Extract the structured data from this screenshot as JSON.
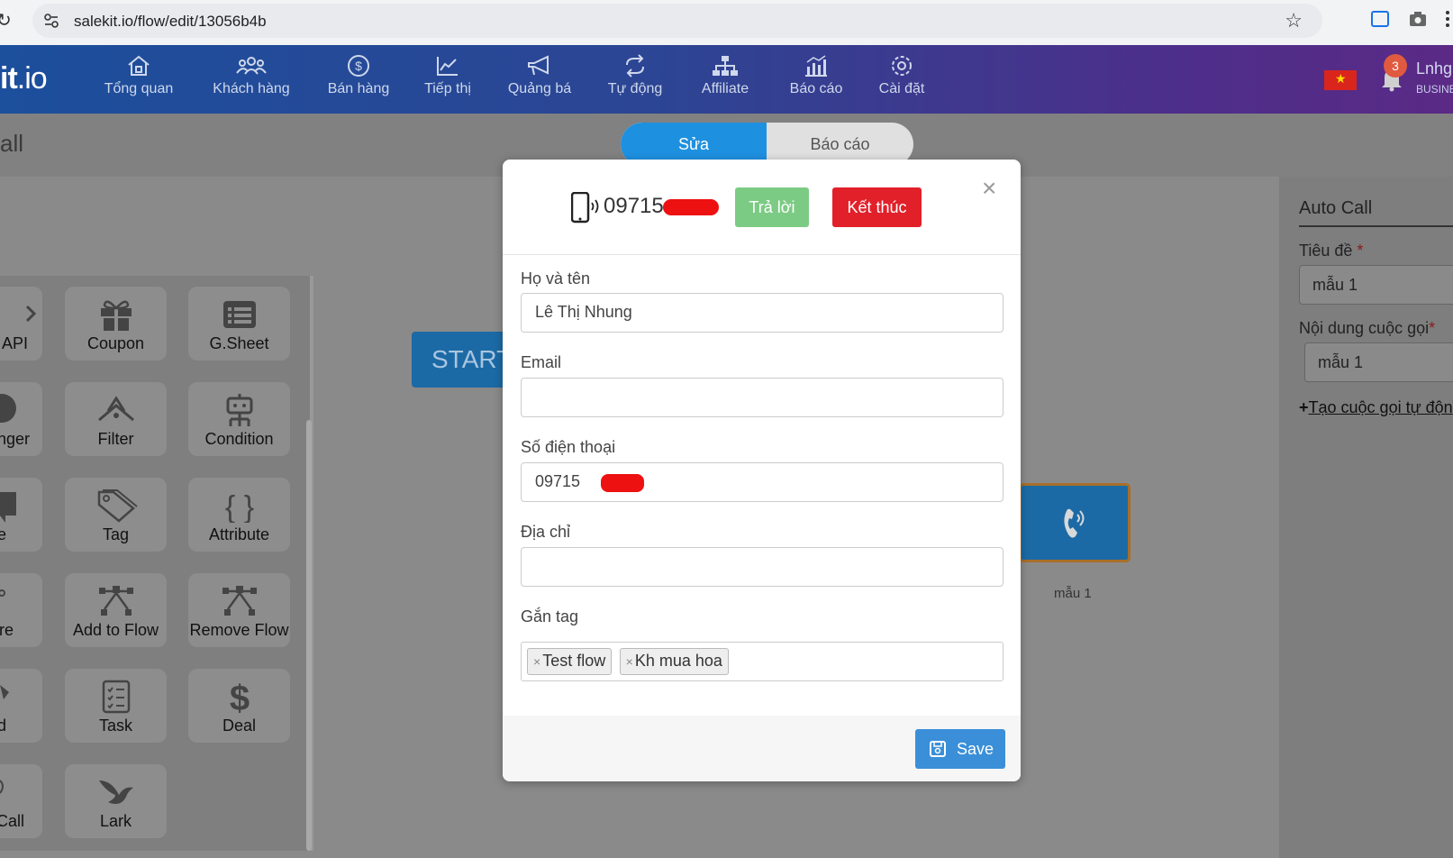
{
  "browser": {
    "url": "salekit.io/flow/edit/13056b4b"
  },
  "app": {
    "logo": {
      "main": "it",
      "suffix": ".io"
    },
    "nav": [
      {
        "label": "Tổng quan",
        "icon": "home-icon"
      },
      {
        "label": "Khách hàng",
        "icon": "users-icon"
      },
      {
        "label": "Bán hàng",
        "icon": "dollar-icon"
      },
      {
        "label": "Tiếp thị",
        "icon": "chart-icon"
      },
      {
        "label": "Quảng bá",
        "icon": "megaphone-icon"
      },
      {
        "label": "Tự động",
        "icon": "automation-icon"
      },
      {
        "label": "Affiliate",
        "icon": "sitemap-icon"
      },
      {
        "label": "Báo cáo",
        "icon": "report-icon"
      },
      {
        "label": "Cài đặt",
        "icon": "gear-icon"
      }
    ],
    "notifications": "3",
    "user": {
      "name": "Lnhg",
      "tier": "BUSINE"
    }
  },
  "page": {
    "title": "all",
    "toggle": {
      "edit": "Sửa",
      "report": "Báo cáo"
    }
  },
  "blocks": [
    {
      "label": "API",
      "icon": "api-icon"
    },
    {
      "label": "Coupon",
      "icon": "gift-icon"
    },
    {
      "label": "G.Sheet",
      "icon": "sheet-icon"
    },
    {
      "label": "nger",
      "icon": "messenger-icon"
    },
    {
      "label": "Filter",
      "icon": "filter-icon"
    },
    {
      "label": "Condition",
      "icon": "condition-icon"
    },
    {
      "label": "e",
      "icon": "note-icon"
    },
    {
      "label": "Tag",
      "icon": "tag-icon"
    },
    {
      "label": "Attribute",
      "icon": "braces-icon"
    },
    {
      "label": "re",
      "icon": "share-icon"
    },
    {
      "label": "Add to Flow",
      "icon": "flow-add-icon"
    },
    {
      "label": "Remove Flow",
      "icon": "flow-remove-icon"
    },
    {
      "label": "d",
      "icon": "send-icon"
    },
    {
      "label": "Task",
      "icon": "task-icon"
    },
    {
      "label": "Deal",
      "icon": "dollar-icon"
    },
    {
      "label": "Call",
      "icon": "call-icon"
    },
    {
      "label": "Lark",
      "icon": "lark-icon"
    }
  ],
  "canvas": {
    "start_label": "START",
    "call_node_label": "mẫu 1"
  },
  "right_panel": {
    "heading": "Auto Call",
    "title_label": "Tiêu đề",
    "title_value": "mẫu 1",
    "content_label": "Nội dung cuộc gọi",
    "content_value": "mẫu 1",
    "required_mark": "*",
    "create_link": "Tạo cuộc gọi tự độn",
    "plus": "+"
  },
  "modal": {
    "phone": "09715",
    "answer": "Trả lời",
    "end": "Kết thúc",
    "close": "×",
    "fields": {
      "name_label": "Họ và tên",
      "name_value": "Lê Thị Nhung",
      "email_label": "Email",
      "email_value": "",
      "phone_label": "Số điện thoại",
      "phone_value": "09715",
      "address_label": "Địa chỉ",
      "address_value": "",
      "tags_label": "Gắn tag"
    },
    "tags": [
      "Test flow",
      "Kh mua hoa"
    ],
    "tag_remove": "×",
    "save": "Save"
  },
  "colors": {
    "accent": "#1e90e0",
    "answer": "#7ccb84",
    "end": "#e2202a",
    "save": "#3b8fd8"
  }
}
